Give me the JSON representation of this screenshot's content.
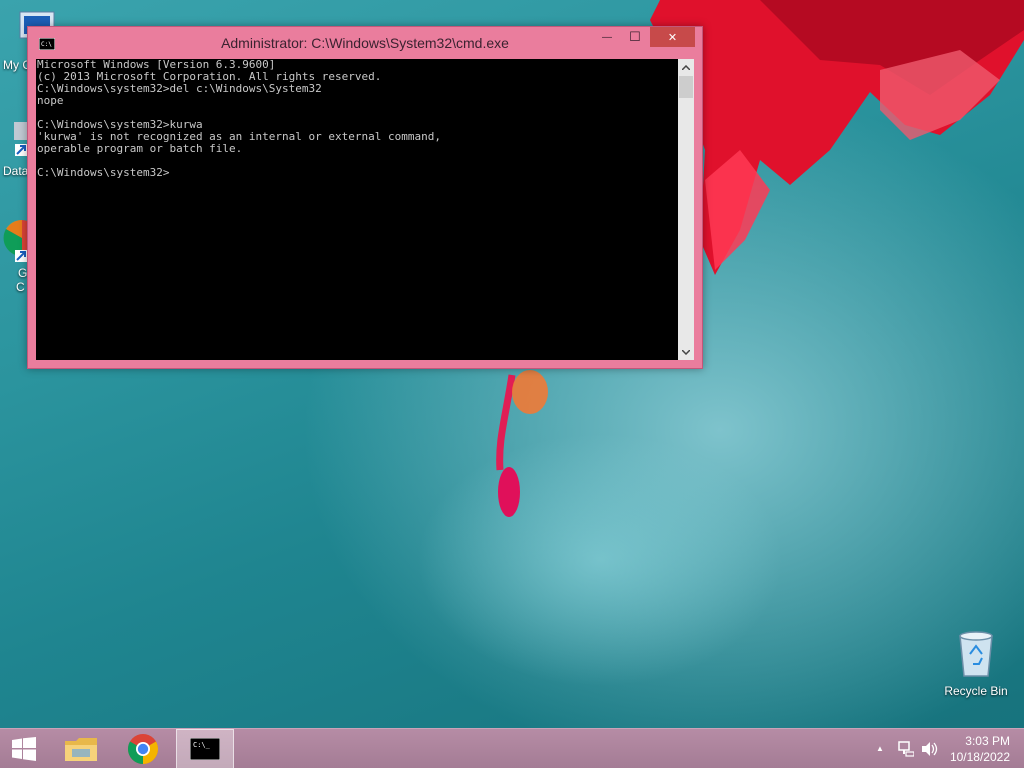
{
  "desktop": {
    "icons": [
      {
        "label": "My C"
      },
      {
        "label": "Data"
      },
      {
        "label": "G"
      },
      {
        "label": "C"
      }
    ],
    "recycle_bin": {
      "label": "Recycle Bin",
      "icon": "recycle-bin-icon"
    }
  },
  "window": {
    "title": "Administrator: C:\\Windows\\System32\\cmd.exe",
    "icon": "cmd-icon",
    "controls": {
      "minimize": "—",
      "maximize": "☐",
      "close": "✕"
    },
    "border_color": "#ea7d9d",
    "console_lines": [
      "Microsoft Windows [Version 6.3.9600]",
      "(c) 2013 Microsoft Corporation. All rights reserved.",
      "C:\\Windows\\system32>del c:\\Windows\\System32",
      "nope",
      "",
      "C:\\Windows\\system32>kurwa",
      "'kurwa' is not recognized as an internal or external command,",
      "operable program or batch file.",
      "",
      "C:\\Windows\\system32>"
    ]
  },
  "taskbar": {
    "buttons": [
      {
        "name": "start-button",
        "icon": "windows-logo-icon"
      },
      {
        "name": "file-explorer-button",
        "icon": "folder-icon"
      },
      {
        "name": "chrome-button",
        "icon": "chrome-icon"
      },
      {
        "name": "cmd-taskbar-button",
        "icon": "cmd-icon",
        "active": true
      }
    ],
    "tray": {
      "show_hidden": "▲"
    },
    "clock": {
      "time": "3:03 PM",
      "date": "10/18/2022"
    }
  }
}
